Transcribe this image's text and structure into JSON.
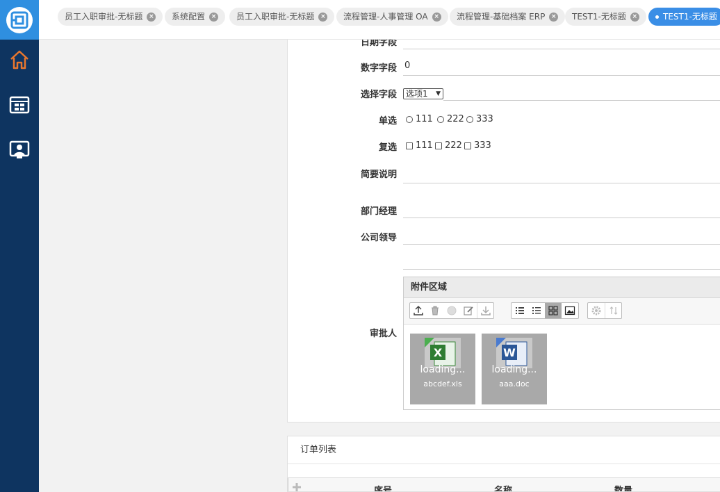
{
  "tabs": [
    {
      "label": "员工入职审批-无标题"
    },
    {
      "label": "系统配置"
    },
    {
      "label": "员工入职审批-无标题"
    },
    {
      "label": "流程管理-人事管理 OA"
    },
    {
      "label": "流程管理-基础档案 ERP"
    },
    {
      "label": "TEST1-无标题"
    },
    {
      "label": "TEST1-无标题"
    }
  ],
  "form": {
    "date_label": "日期字段",
    "number_label": "数字字段",
    "number_value": "0",
    "select_label": "选择字段",
    "select_value": "选项1",
    "radio_label": "单选",
    "radio_options": [
      "111",
      "222",
      "333"
    ],
    "check_label": "复选",
    "check_options": [
      "111",
      "222",
      "333"
    ],
    "summary_label": "简要说明",
    "dept_manager_label": "部门经理",
    "company_leader_label": "公司领导",
    "approver_label": "审批人"
  },
  "attachments": {
    "title": "附件区域",
    "files": [
      {
        "name": "abcdef.xls",
        "status": "loading...",
        "icon": "excel-icon",
        "tag": "XLS"
      },
      {
        "name": "aaa.doc",
        "status": "loading...",
        "icon": "word-icon",
        "tag": "DOC"
      }
    ]
  },
  "order_list": {
    "title": "订单列表",
    "columns": [
      "序号",
      "名称",
      "数量"
    ]
  },
  "colors": {
    "sidebar": "#0e3460",
    "accent": "#3a8ee6",
    "home_icon": "#e8772e"
  }
}
